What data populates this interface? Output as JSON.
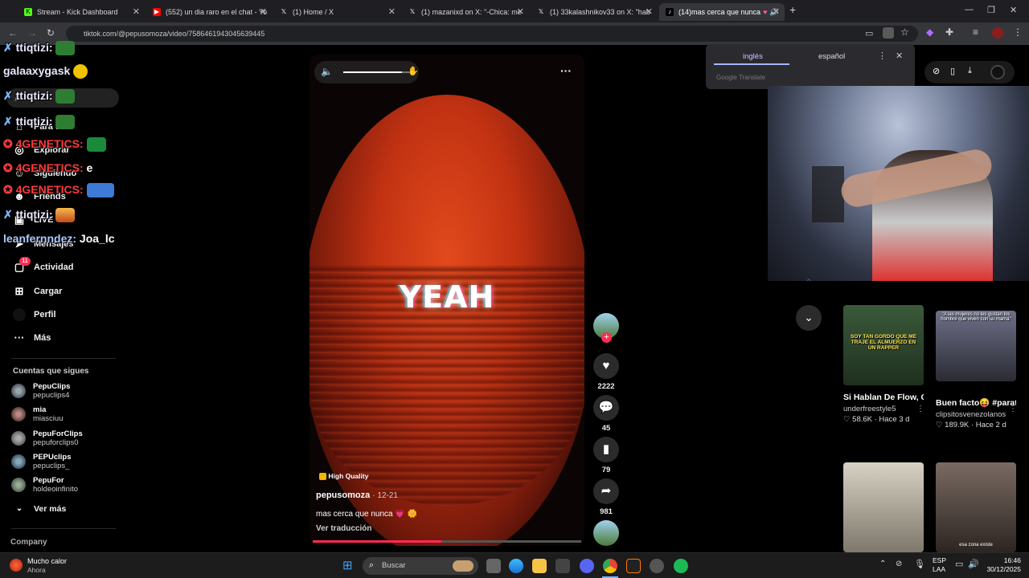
{
  "browser": {
    "tabs": [
      {
        "title": "Stream - Kick Dashboard",
        "favicon": "kick-icon"
      },
      {
        "title": "(552) un dia raro en el chat - Yo",
        "favicon": "youtube-icon"
      },
      {
        "title": "(1) Home / X",
        "favicon": "x-icon"
      },
      {
        "title": "(1) mazanixd on X: \"-Chica: me",
        "favicon": "x-icon"
      },
      {
        "title": "(1) 33kalashnikov33 on X: \"hab",
        "favicon": "x-icon"
      },
      {
        "title": "(14)mas cerca que nunca",
        "favicon": "tiktok-icon"
      }
    ],
    "url": "tiktok.com/@pepusomoza/video/7586461943045639445"
  },
  "translate": {
    "lang_from": "inglés",
    "lang_to": "español",
    "brand": "Google Translate"
  },
  "sidebar": {
    "items": [
      {
        "label": "Para ti"
      },
      {
        "label": "Explorar"
      },
      {
        "label": "Siguiendo"
      },
      {
        "label": "Friends"
      },
      {
        "label": "LIVE"
      },
      {
        "label": "Mensajes"
      },
      {
        "label": "Actividad",
        "badge": "11"
      },
      {
        "label": "Cargar"
      },
      {
        "label": "Perfil"
      },
      {
        "label": "Más"
      }
    ],
    "following_title": "Cuentas que sigues",
    "following": [
      {
        "name": "PepuClips",
        "handle": "pepuclips4"
      },
      {
        "name": "mia",
        "handle": "miasciuu"
      },
      {
        "name": "PepuForClips",
        "handle": "pepuforclips0"
      },
      {
        "name": "PEPUclips",
        "handle": "pepuclips_"
      },
      {
        "name": "PepuFor",
        "handle": "holdeoinfinito"
      }
    ],
    "see_more": "Ver más",
    "company": "Company"
  },
  "chat": [
    {
      "user": "ttiqtizi:",
      "text": ""
    },
    {
      "user": "galaaxygask",
      "text": ""
    },
    {
      "user": "ttiqtizi:",
      "text": ""
    },
    {
      "user": "ttiqtizi:",
      "text": ""
    },
    {
      "user": "4GENETICS:",
      "text": ""
    },
    {
      "user": "4GENETICS:",
      "text": "e"
    },
    {
      "user": "4GENETICS:",
      "text": ""
    },
    {
      "user": "ttiqtizi:",
      "text": ""
    },
    {
      "user": "leanfernndez:",
      "text": "Joa_lc"
    }
  ],
  "video": {
    "overlay_text": "YEAH",
    "quality_badge": "High Quality",
    "author": "pepusomoza",
    "date": "· 12-21",
    "caption": "mas cerca que nunca 💗 🌼",
    "translate_link": "Ver traducción",
    "progress": 0.48,
    "volume": 0.85,
    "likes": "2222",
    "comments": "45",
    "saves": "79",
    "shares": "981"
  },
  "recommended": [
    {
      "title": "Si Hablan De Flow, Que Tengan Flow...",
      "author": "underfreestyle5",
      "stats": "♡ 58.6K · Hace 3 d",
      "thumb_text": "SOY TAN GORDO QUE ME TRAJE EL ALMUERZO EN UN RAPPER",
      "color": "#3b6a3a"
    },
    {
      "title": "Buen facto😝 #parati #fyp #vir...",
      "author": "clipsitosvenezolanos",
      "stats": "♡ 189.9K · Hace 2 d",
      "thumb_text": "\"A las mujeres no les gustan los hombre que viven con su mamá\"",
      "color": "#4a3f3a"
    },
    {
      "title": "",
      "author": "",
      "stats": "",
      "thumb_text": "",
      "color": "#8a8780"
    },
    {
      "title": "",
      "author": "",
      "stats": "",
      "thumb_text": "esa zona existe",
      "color": "#5a4a44"
    }
  ],
  "taskbar": {
    "weather_title": "Mucho calor",
    "weather_sub": "Ahora",
    "search_placeholder": "Buscar",
    "lang": "ESP",
    "lang_sub": "LAA",
    "time": "16:46",
    "date": "30/12/2025"
  }
}
